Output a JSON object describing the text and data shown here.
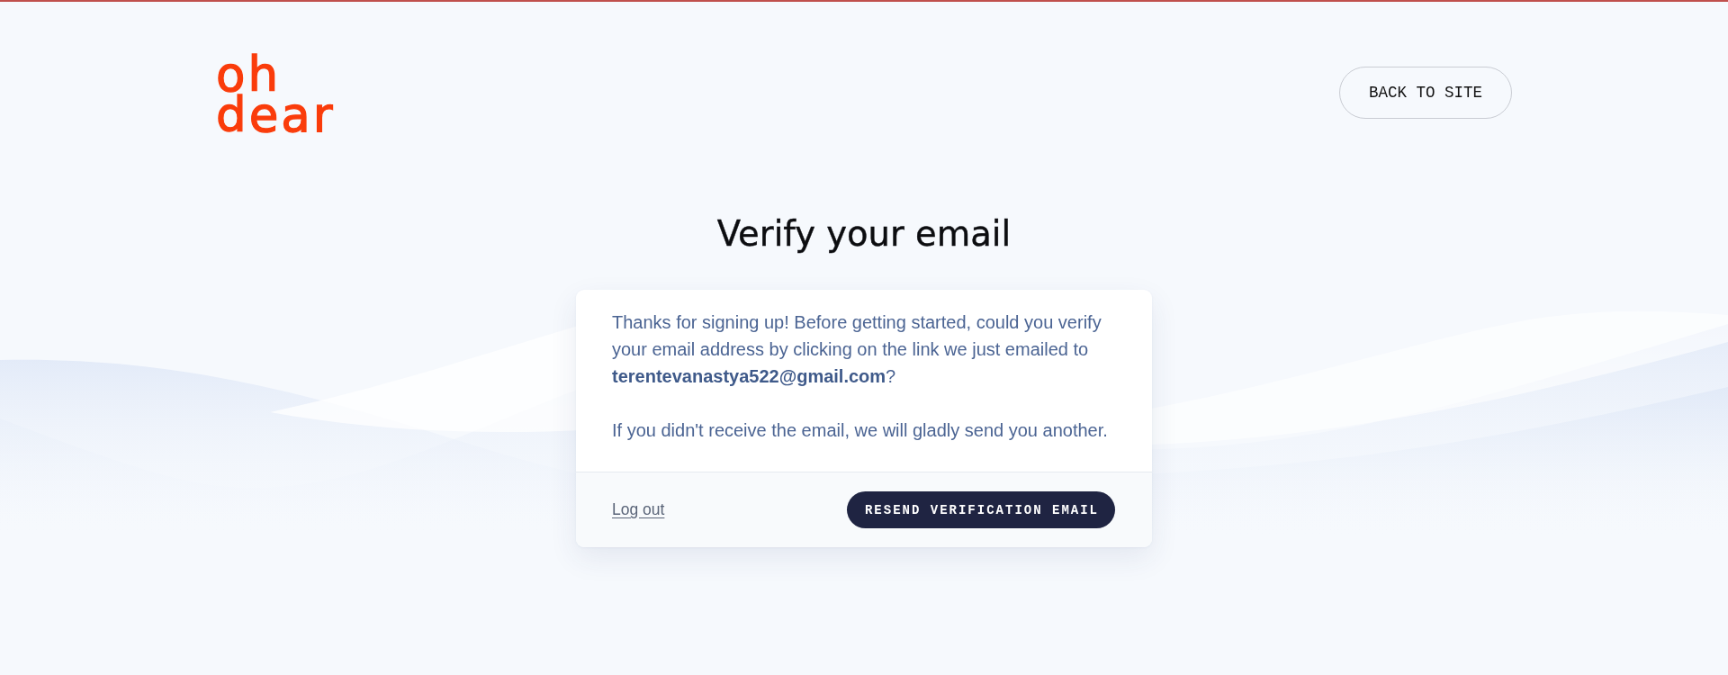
{
  "logo": {
    "lines": [
      "oh",
      "dear"
    ]
  },
  "header": {
    "back_button": "BACK TO SITE"
  },
  "title": "Verify your email",
  "card": {
    "paragraphs": [
      "Thanks for signing up! Before getting started, could you verify your email address by clicking on the link we just emailed to **terentevanastya522@gmail.com**?",
      "If you didn't receive the email, we will gladly send you another."
    ],
    "logout_link": "Log out",
    "resend_button": "RESEND VERIFICATION EMAIL"
  }
}
